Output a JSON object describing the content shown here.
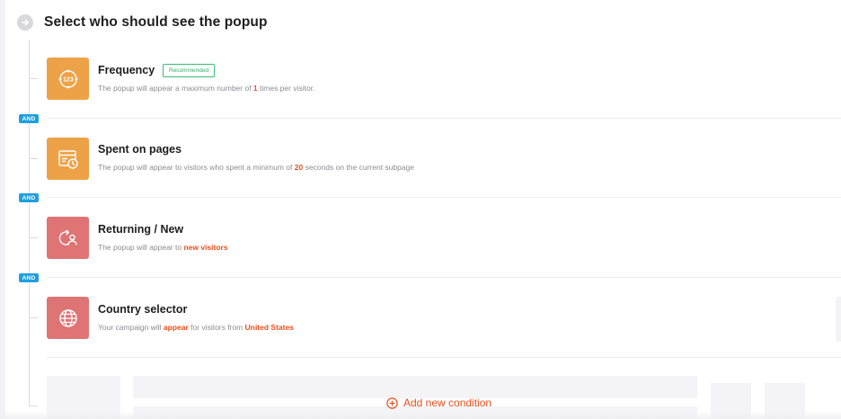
{
  "header": {
    "title": "Select who should see the popup"
  },
  "connector": {
    "and_label": "AND"
  },
  "conditions": [
    {
      "title": "Frequency",
      "badge": "Recommended",
      "icon": "counter-123-icon",
      "color": "#eea247",
      "desc_before": "The popup will appear a maximum number of ",
      "desc_highlight": "1",
      "desc_after": " times per visitor."
    },
    {
      "title": "Spent on pages",
      "icon": "page-timer-icon",
      "color": "#eea247",
      "desc_before": "The popup will appear to visitors who spent a minimum of ",
      "desc_highlight": "20",
      "desc_after": " seconds on the current subpage"
    },
    {
      "title": "Returning / New",
      "icon": "returning-visitor-icon",
      "color": "#de7474",
      "desc_before": "The popup will appear to ",
      "desc_highlight": "new visitors",
      "desc_after": ""
    },
    {
      "title": "Country selector",
      "icon": "globe-icon",
      "color": "#de7474",
      "desc_before": "Your campaign will ",
      "desc_highlight": "appear",
      "desc_middle": " for visitors from ",
      "desc_highlight2": "United States"
    }
  ],
  "actions": {
    "add_condition": "Add new condition"
  },
  "colors": {
    "accent": "#e8501c",
    "and_badge": "#1f9fe0",
    "recommended": "#2fae66"
  }
}
